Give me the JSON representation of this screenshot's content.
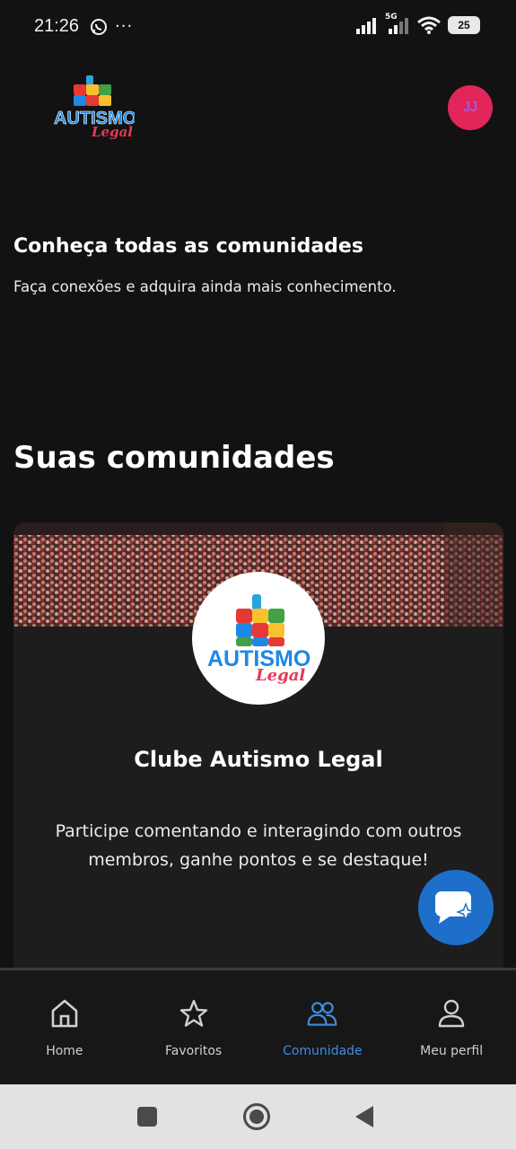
{
  "status": {
    "time": "21:26",
    "network_label": "5G",
    "battery": "25"
  },
  "header": {
    "logo_text_main": "AUTISMO",
    "logo_text_sub": "Legal",
    "avatar_initials": "JJ"
  },
  "intro": {
    "title": "Conheça todas as comunidades",
    "subtitle": "Faça conexões e adquira ainda mais conhecimento."
  },
  "section": {
    "title": "Suas comunidades"
  },
  "community_card": {
    "title": "Clube Autismo Legal",
    "description": "Participe comentando e interagindo com outros membros, ganhe pontos e se destaque!",
    "logo_text_main": "AUTISMO",
    "logo_text_sub": "Legal"
  },
  "bottom_nav": {
    "items": [
      {
        "label": "Home",
        "icon": "home-icon"
      },
      {
        "label": "Favoritos",
        "icon": "star-icon"
      },
      {
        "label": "Comunidade",
        "icon": "community-icon"
      },
      {
        "label": "Meu perfil",
        "icon": "profile-icon"
      }
    ],
    "active_index": 2
  },
  "colors": {
    "background": "#121212",
    "accent": "#3b8fe0",
    "avatar": "#e3265a",
    "fab": "#1e6fc9"
  }
}
